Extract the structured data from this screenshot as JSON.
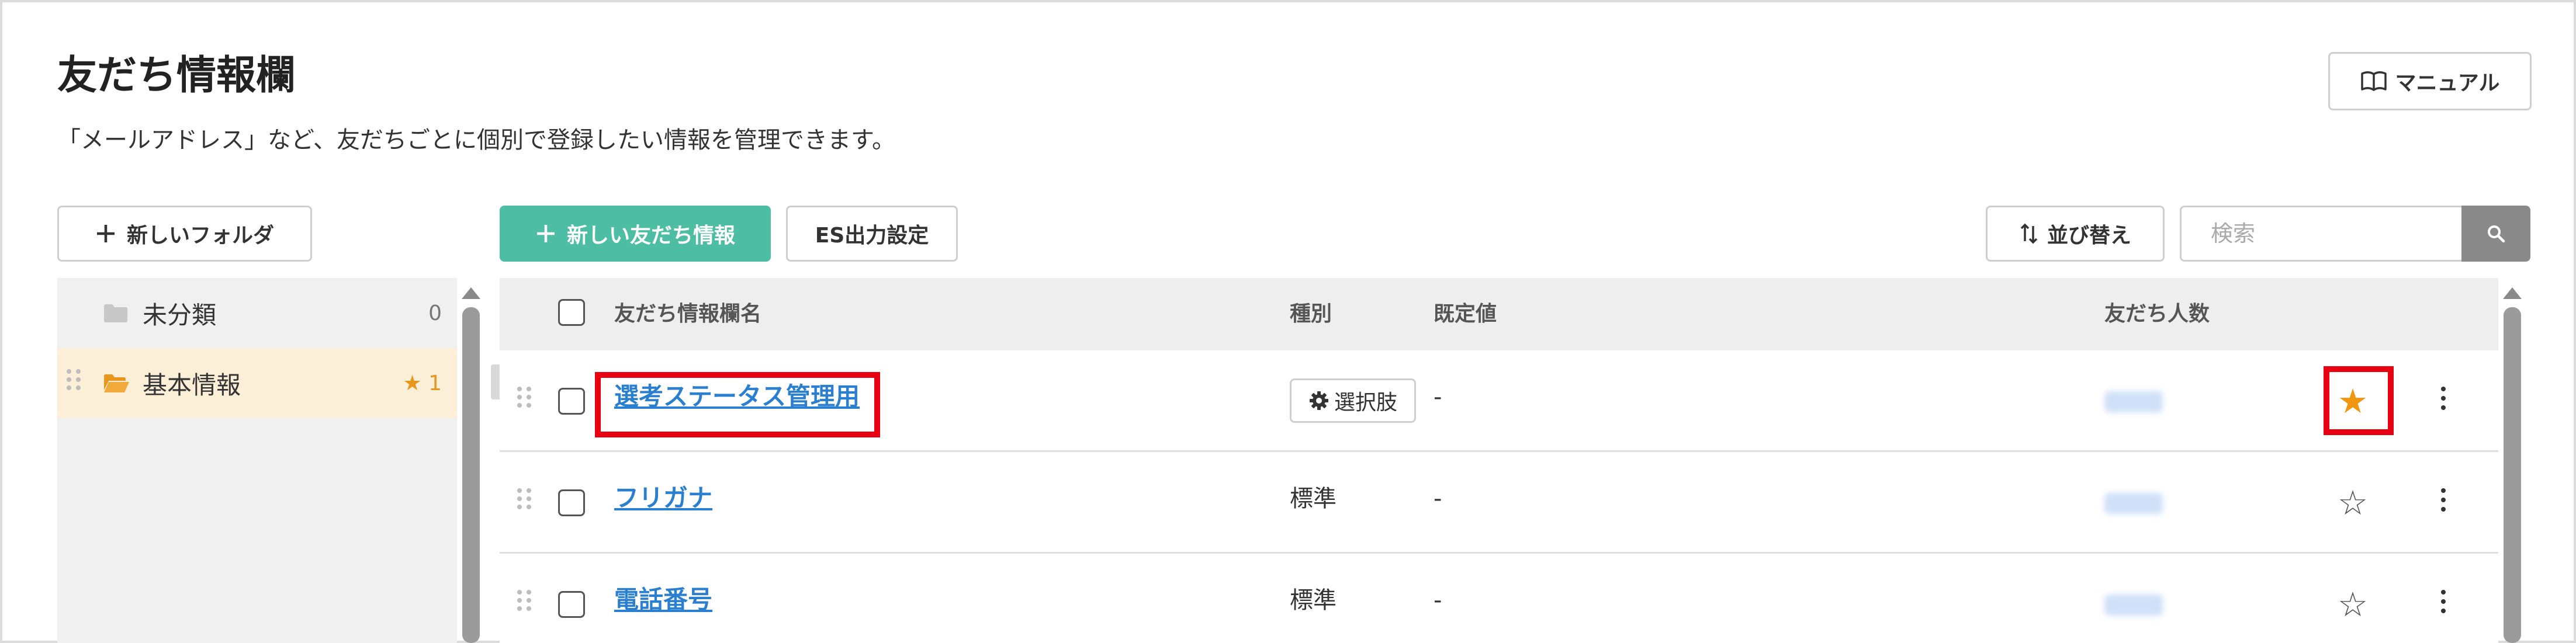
{
  "page": {
    "title": "友だち情報欄",
    "description": "「メールアドレス」など、友だちごとに個別で登録したい情報を管理できます。"
  },
  "toolbar": {
    "manual_label": "マニュアル",
    "new_folder_label": "新しいフォルダ",
    "new_info_label": "新しい友だち情報",
    "es_export_label": "ES出力設定",
    "sort_label": "並び替え",
    "search_placeholder": "検索"
  },
  "folders": [
    {
      "name": "未分類",
      "count": "0",
      "icon": "folder-icon",
      "selected": false
    },
    {
      "name": "基本情報",
      "count": "★ 1",
      "icon": "folder-open-icon",
      "selected": true
    }
  ],
  "table": {
    "headers": {
      "name": "友だち情報欄名",
      "type": "種別",
      "default": "既定値",
      "friends": "友だち人数"
    },
    "rows": [
      {
        "name": "選考ステータス管理用",
        "type": "選択肢",
        "type_icon": "gear-icon",
        "default": "-",
        "starred": true
      },
      {
        "name": "フリガナ",
        "type": "標準",
        "default": "-",
        "starred": false
      },
      {
        "name": "電話番号",
        "type": "標準",
        "default": "-",
        "starred": false
      }
    ]
  },
  "colors": {
    "accent": "#4dbea4",
    "link": "#2b7fd0",
    "star": "#f0960f",
    "highlight": "#e60012",
    "selected_folder": "#fcefd8"
  }
}
